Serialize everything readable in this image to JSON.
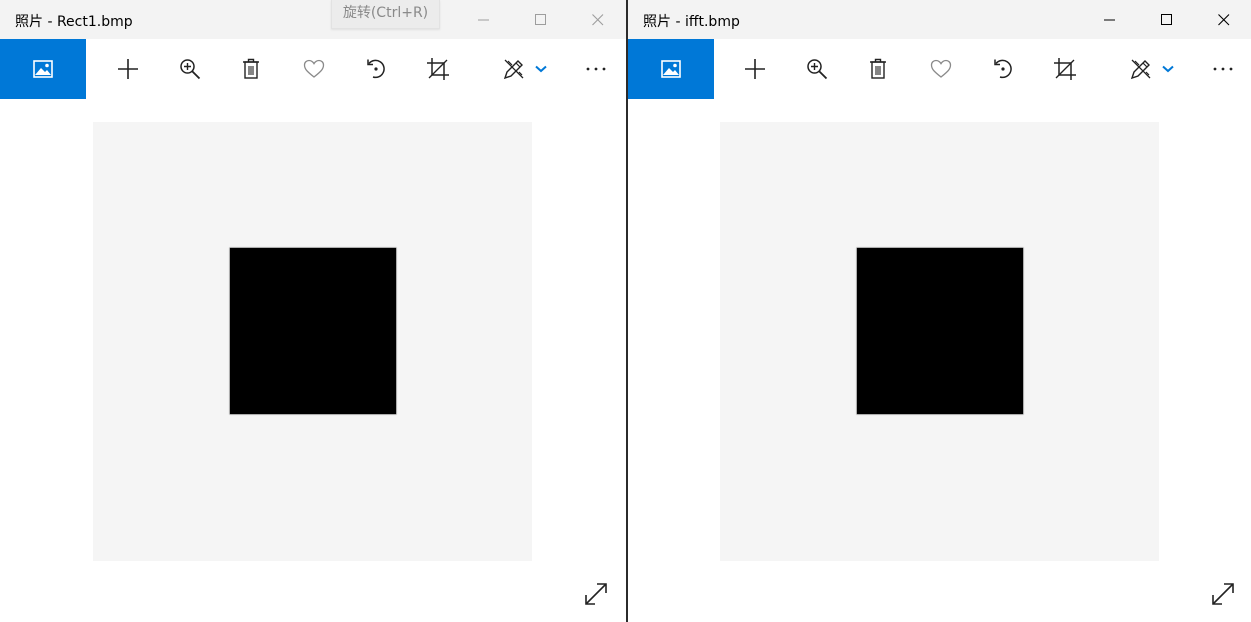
{
  "windows": [
    {
      "title": "照片 - Rect1.bmp",
      "inactive_controls": true
    },
    {
      "title": "照片 - ifft.bmp",
      "inactive_controls": false
    }
  ],
  "tooltip": {
    "text": "旋转(Ctrl+R)"
  },
  "toolbar_icons": [
    "photo-icon",
    "plus-icon",
    "zoom-in-icon",
    "trash-icon",
    "heart-icon",
    "rotate-icon",
    "crop-icon",
    "edit-draw-icon",
    "chevron-down-icon",
    "more-icon"
  ],
  "image_content": {
    "background": "#f5f5f5",
    "square_color": "#000000"
  },
  "colors": {
    "accent": "#0078d7",
    "titlebar": "#f3f3f3",
    "chevron": "#0078d7"
  }
}
